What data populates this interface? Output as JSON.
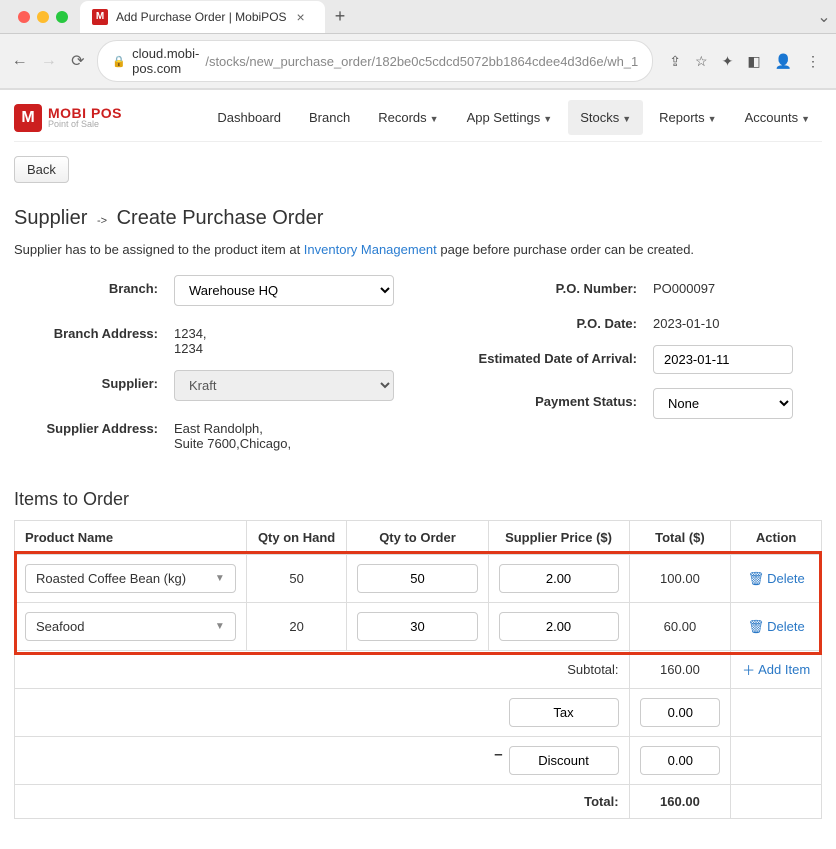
{
  "browser": {
    "tab_title": "Add Purchase Order | MobiPOS",
    "url_host": "cloud.mobi-pos.com",
    "url_path": "/stocks/new_purchase_order/182be0c5cdcd5072bb1864cdee4d3d6e/wh_1"
  },
  "logo": {
    "line1": "MOBI POS",
    "line2": "Point of Sale",
    "mark": "M"
  },
  "menu": {
    "dashboard": "Dashboard",
    "branch": "Branch",
    "records": "Records",
    "app_settings": "App Settings",
    "stocks": "Stocks",
    "reports": "Reports",
    "accounts": "Accounts"
  },
  "back_label": "Back",
  "title": {
    "crumb": "Supplier",
    "page": "Create Purchase Order"
  },
  "info": {
    "prefix": "Supplier has to be assigned to the product item at ",
    "link": "Inventory Management",
    "suffix": " page before purchase order can be created."
  },
  "form": {
    "branch_label": "Branch:",
    "branch_value": "Warehouse HQ",
    "branch_address_label": "Branch Address:",
    "branch_address_l1": "1234,",
    "branch_address_l2": "1234",
    "supplier_label": "Supplier:",
    "supplier_value": "Kraft",
    "supplier_address_label": "Supplier Address:",
    "supplier_address_l1": "East Randolph,",
    "supplier_address_l2": "Suite 7600,Chicago,",
    "po_number_label": "P.O. Number:",
    "po_number_value": "PO000097",
    "po_date_label": "P.O. Date:",
    "po_date_value": "2023-01-10",
    "eta_label": "Estimated Date of Arrival:",
    "eta_value": "2023-01-11",
    "payment_status_label": "Payment Status:",
    "payment_status_value": "None"
  },
  "items_title": "Items to Order",
  "headers": {
    "product": "Product Name",
    "qty_hand": "Qty on Hand",
    "qty_order": "Qty to Order",
    "price": "Supplier Price ($)",
    "total": "Total ($)",
    "action": "Action"
  },
  "rows": [
    {
      "product": "Roasted Coffee Bean (kg)",
      "qty_hand": "50",
      "qty_order": "50",
      "price": "2.00",
      "total": "100.00"
    },
    {
      "product": "Seafood",
      "qty_hand": "20",
      "qty_order": "30",
      "price": "2.00",
      "total": "60.00"
    }
  ],
  "summary": {
    "subtotal_label": "Subtotal:",
    "subtotal_value": "160.00",
    "tax_label": "Tax",
    "tax_value": "0.00",
    "discount_label": "Discount",
    "discount_value": "0.00",
    "total_label": "Total:",
    "total_value": "160.00"
  },
  "actions": {
    "delete": "Delete",
    "add_item": "Add Item"
  }
}
